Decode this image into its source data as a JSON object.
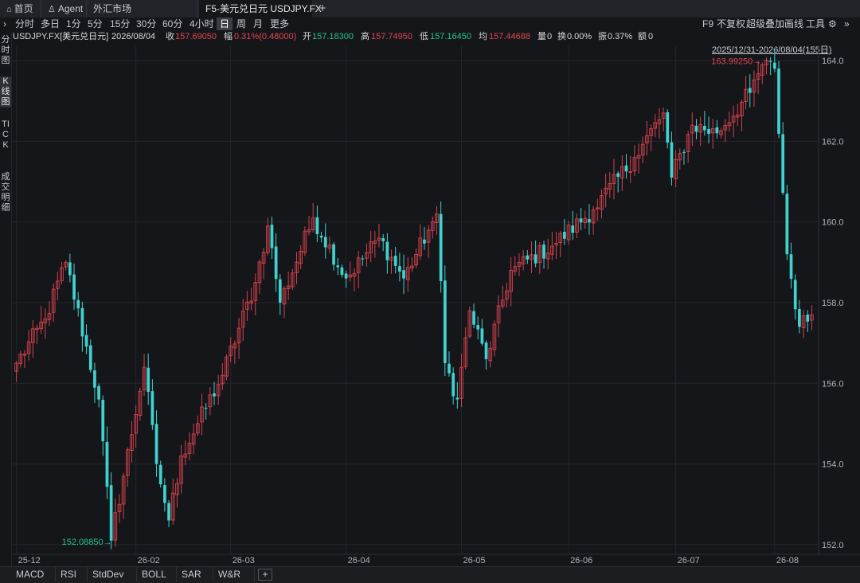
{
  "tabs": [
    {
      "label": "首页",
      "icon": "home-icon"
    },
    {
      "label": "Agent",
      "icon": "agent-icon"
    },
    {
      "label": "外汇市场"
    },
    {
      "label": "F5-美元兑日元 USDJPY.FX",
      "active": true
    }
  ],
  "toolbar": {
    "periods": [
      "分时",
      "多日",
      "1分",
      "5分",
      "15分",
      "30分",
      "60分",
      "4小时",
      "日",
      "周",
      "月",
      "更多"
    ],
    "active_period": "日",
    "right": [
      "F9",
      "不复权",
      "超级叠加",
      "画线",
      "工具"
    ]
  },
  "info": {
    "symbol": "USDJPY.FX[美元兑日元]",
    "date": "2026/08/04",
    "close_label": "收",
    "close": "157.69050",
    "change_label": "幅",
    "change": "0.31%(0.48000)",
    "open_label": "开",
    "open": "157.18300",
    "high_label": "高",
    "high": "157.74950",
    "low_label": "低",
    "low": "157.16450",
    "avg_label": "均",
    "avg": "157.44688",
    "vol_label": "量",
    "vol": "0",
    "turn_label": "换",
    "turn": "0.00%",
    "amp_label": "振",
    "amp": "0.37%",
    "amt_label": "额",
    "amt": "0"
  },
  "sidebar": [
    "分时图",
    "K线图",
    "TICK",
    "成交明细"
  ],
  "range_label": "2025/12/31-2026/08/04(155日)",
  "colors": {
    "up": "#d6424c",
    "down": "#3fd2cf",
    "bg": "#14161a",
    "grid": "#23262b"
  },
  "chart_data": {
    "type": "candlestick",
    "ylim": [
      151.8,
      164.2
    ],
    "yticks": [
      "152.0",
      "154.0",
      "156.0",
      "158.0",
      "160.0",
      "162.0",
      "164.0"
    ],
    "xticks": [
      "25-12",
      "26-02",
      "26-03",
      "26-04",
      "26-05",
      "26-06",
      "26-07",
      "26-08"
    ],
    "xtick_index": [
      0,
      29,
      52,
      80,
      108,
      134,
      160,
      184
    ],
    "max_label": "163.99250",
    "min_label": "152.08850",
    "key_points": [
      {
        "i": 0,
        "v": 156.5
      },
      {
        "i": 7,
        "v": 157.6
      },
      {
        "i": 12,
        "v": 159.0
      },
      {
        "i": 20,
        "v": 155.6
      },
      {
        "i": 23,
        "v": 152.1
      },
      {
        "i": 31,
        "v": 156.4
      },
      {
        "i": 34,
        "v": 154.0
      },
      {
        "i": 37,
        "v": 152.6
      },
      {
        "i": 40,
        "v": 154.2
      },
      {
        "i": 50,
        "v": 156.2
      },
      {
        "i": 58,
        "v": 158.5
      },
      {
        "i": 61,
        "v": 159.9
      },
      {
        "i": 64,
        "v": 158.0
      },
      {
        "i": 72,
        "v": 160.1
      },
      {
        "i": 80,
        "v": 158.6
      },
      {
        "i": 88,
        "v": 159.6
      },
      {
        "i": 94,
        "v": 158.6
      },
      {
        "i": 100,
        "v": 159.8
      },
      {
        "i": 102,
        "v": 160.2
      },
      {
        "i": 104,
        "v": 156.5
      },
      {
        "i": 107,
        "v": 155.6
      },
      {
        "i": 110,
        "v": 157.8
      },
      {
        "i": 114,
        "v": 156.6
      },
      {
        "i": 120,
        "v": 158.8
      },
      {
        "i": 130,
        "v": 159.4
      },
      {
        "i": 140,
        "v": 160.3
      },
      {
        "i": 150,
        "v": 161.6
      },
      {
        "i": 157,
        "v": 162.7
      },
      {
        "i": 159,
        "v": 161.1
      },
      {
        "i": 164,
        "v": 162.4
      },
      {
        "i": 170,
        "v": 162.2
      },
      {
        "i": 178,
        "v": 163.2
      },
      {
        "i": 181,
        "v": 163.9
      },
      {
        "i": 184,
        "v": 163.8
      },
      {
        "i": 187,
        "v": 159.2
      },
      {
        "i": 190,
        "v": 157.4
      },
      {
        "i": 193,
        "v": 157.7
      }
    ],
    "count": 194
  },
  "indicators": [
    "MACD",
    "RSI",
    "StdDev",
    "BOLL",
    "SAR",
    "W&R"
  ]
}
